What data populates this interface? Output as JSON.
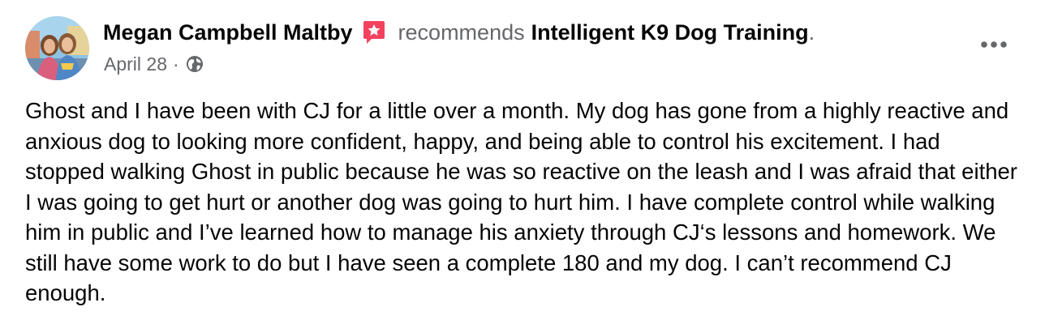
{
  "post": {
    "author": "Megan Campbell Maltby",
    "author_badge_icon": "star-badge-icon",
    "action": "recommends",
    "page_name": "Intelligent K9 Dog Training",
    "period": ".",
    "date": "April 28",
    "separator": "·",
    "privacy_icon": "globe-icon",
    "more_icon": "more-options-icon",
    "text": "Ghost and I have been with CJ for a little over a month. My dog has gone from a highly reactive and anxious dog to looking more confident, happy, and being able to control his excitement. I had stopped walking Ghost in public because he was so reactive on the leash and I was afraid that either I was going to get hurt or another dog was going to hurt him. I have complete control while walking him in public and I’ve learned how to manage his anxiety through CJ‘s lessons and homework. We still have some work to do but I have seen a complete 180 and my dog. I can’t recommend CJ enough."
  },
  "colors": {
    "primary_text": "#050505",
    "secondary_text": "#65676b",
    "badge": "#f3425f",
    "background": "#ffffff"
  }
}
